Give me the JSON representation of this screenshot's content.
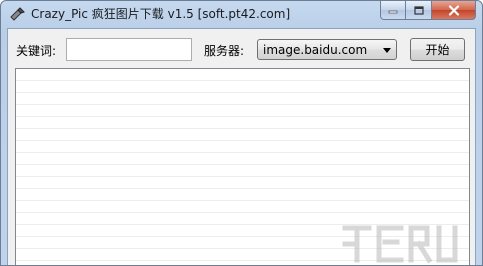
{
  "window": {
    "title": "Crazy_Pic 疯狂图片下载 v1.5 [soft.pt42.com]",
    "icon": "tool-icon"
  },
  "caption_buttons": {
    "minimize_icon": "minimize-icon",
    "maximize_icon": "maximize-icon",
    "close_icon": "close-icon"
  },
  "toolbar": {
    "keyword_label": "关键词:",
    "keyword_value": "",
    "server_label": "服务器:",
    "server_selected": "image.baidu.com",
    "start_label": "开始"
  },
  "colors": {
    "title_bar": "#c5d9ef",
    "client_bg": "#f0f0f0",
    "close_button": "#c4442a"
  }
}
